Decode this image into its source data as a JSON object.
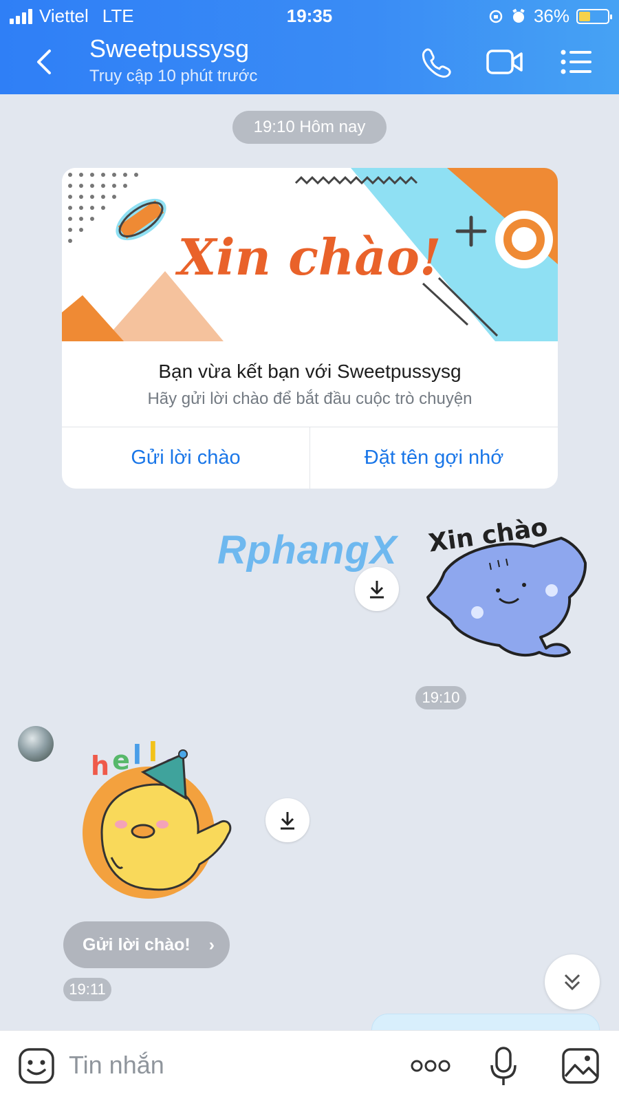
{
  "status_bar": {
    "carrier": "Viettel",
    "network": "LTE",
    "time": "19:35",
    "battery": "36%"
  },
  "header": {
    "title": "Sweetpussysg",
    "subtitle": "Truy cập 10 phút trước",
    "back_icon": "chevron-left-icon",
    "call_icon": "phone-icon",
    "video_icon": "video-camera-icon",
    "menu_icon": "list-menu-icon"
  },
  "chat": {
    "date_separator": "19:10 Hôm nay",
    "card": {
      "banner_text": "Xin chào!",
      "title": "Bạn vừa kết bạn với Sweetpussysg",
      "subtitle": "Hãy gửi lời chào để bắt đầu cuộc trò chuyện",
      "button_left": "Gửi lời chào",
      "button_right": "Đặt tên gợi nhớ"
    },
    "watermark": "RphangX",
    "sticker_sent_text": "Xin chào",
    "sent_time": "19:10",
    "sticker_received_text": "hello",
    "greeting_chip": "Gửi lời chào!",
    "received_time": "19:11"
  },
  "input": {
    "placeholder": "Tin nhắn"
  },
  "colors": {
    "header_blue": "#2f7ff6",
    "link_blue": "#1976e8",
    "chat_bg": "#e2e7ef",
    "orange": "#ef8a34",
    "cyan": "#8fe0f3"
  }
}
